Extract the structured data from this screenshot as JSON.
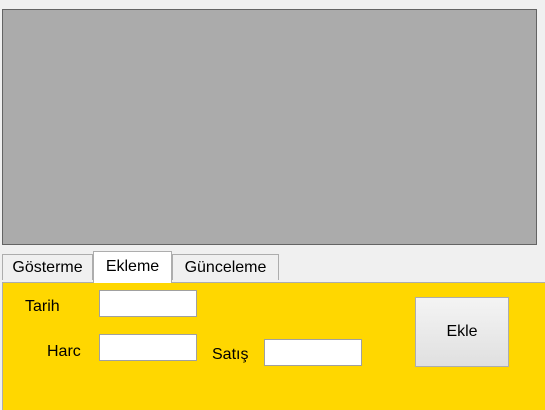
{
  "tabs": [
    {
      "label": "Gösterme",
      "active": false
    },
    {
      "label": "Ekleme",
      "active": true
    },
    {
      "label": "Günceleme",
      "active": false
    }
  ],
  "form": {
    "tarih_label": "Tarih",
    "harc_label": "Harc",
    "satis_label": "Satış",
    "tarih_value": "",
    "harc_value": "",
    "satis_value": "",
    "ekle_button": "Ekle"
  },
  "colors": {
    "panel_background": "#ffd700",
    "grid_background": "#ababab"
  }
}
